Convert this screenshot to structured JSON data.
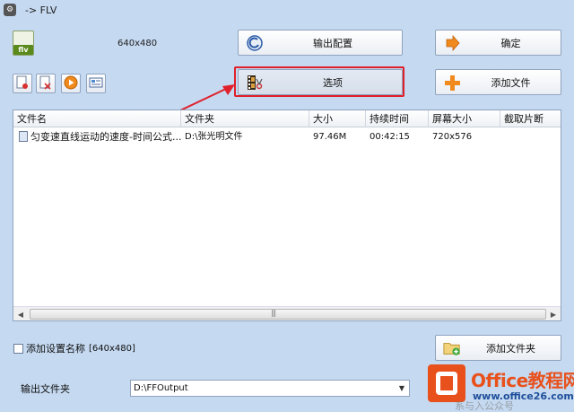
{
  "window": {
    "title": "-> FLV"
  },
  "format": {
    "badge": "flv",
    "resolution": "640x480"
  },
  "buttons": {
    "output_config": "输出配置",
    "ok": "确定",
    "options": "选项",
    "add_file": "添加文件",
    "add_folder": "添加文件夹"
  },
  "file_list": {
    "columns": [
      "文件名",
      "文件夹",
      "大小",
      "持续时间",
      "屏幕大小",
      "截取片断"
    ],
    "rows": [
      {
        "name": "匀变速直线运动的速度-时间公式...",
        "folder": "D:\\张光明文件",
        "size": "97.46M",
        "duration": "00:42:15",
        "screen": "720x576",
        "clip": ""
      }
    ]
  },
  "settings": {
    "add_name_label": "添加设置名称",
    "add_name_value": "[640x480]"
  },
  "output": {
    "label": "输出文件夹",
    "value": "D:\\FFOutput"
  },
  "watermark": {
    "title": "Office教程网",
    "url": "www.office26.com",
    "sub": "系与入公众号"
  },
  "colors": {
    "background": "#c5d9f1",
    "highlight": "#e0202a",
    "brand": "#e8511c"
  }
}
